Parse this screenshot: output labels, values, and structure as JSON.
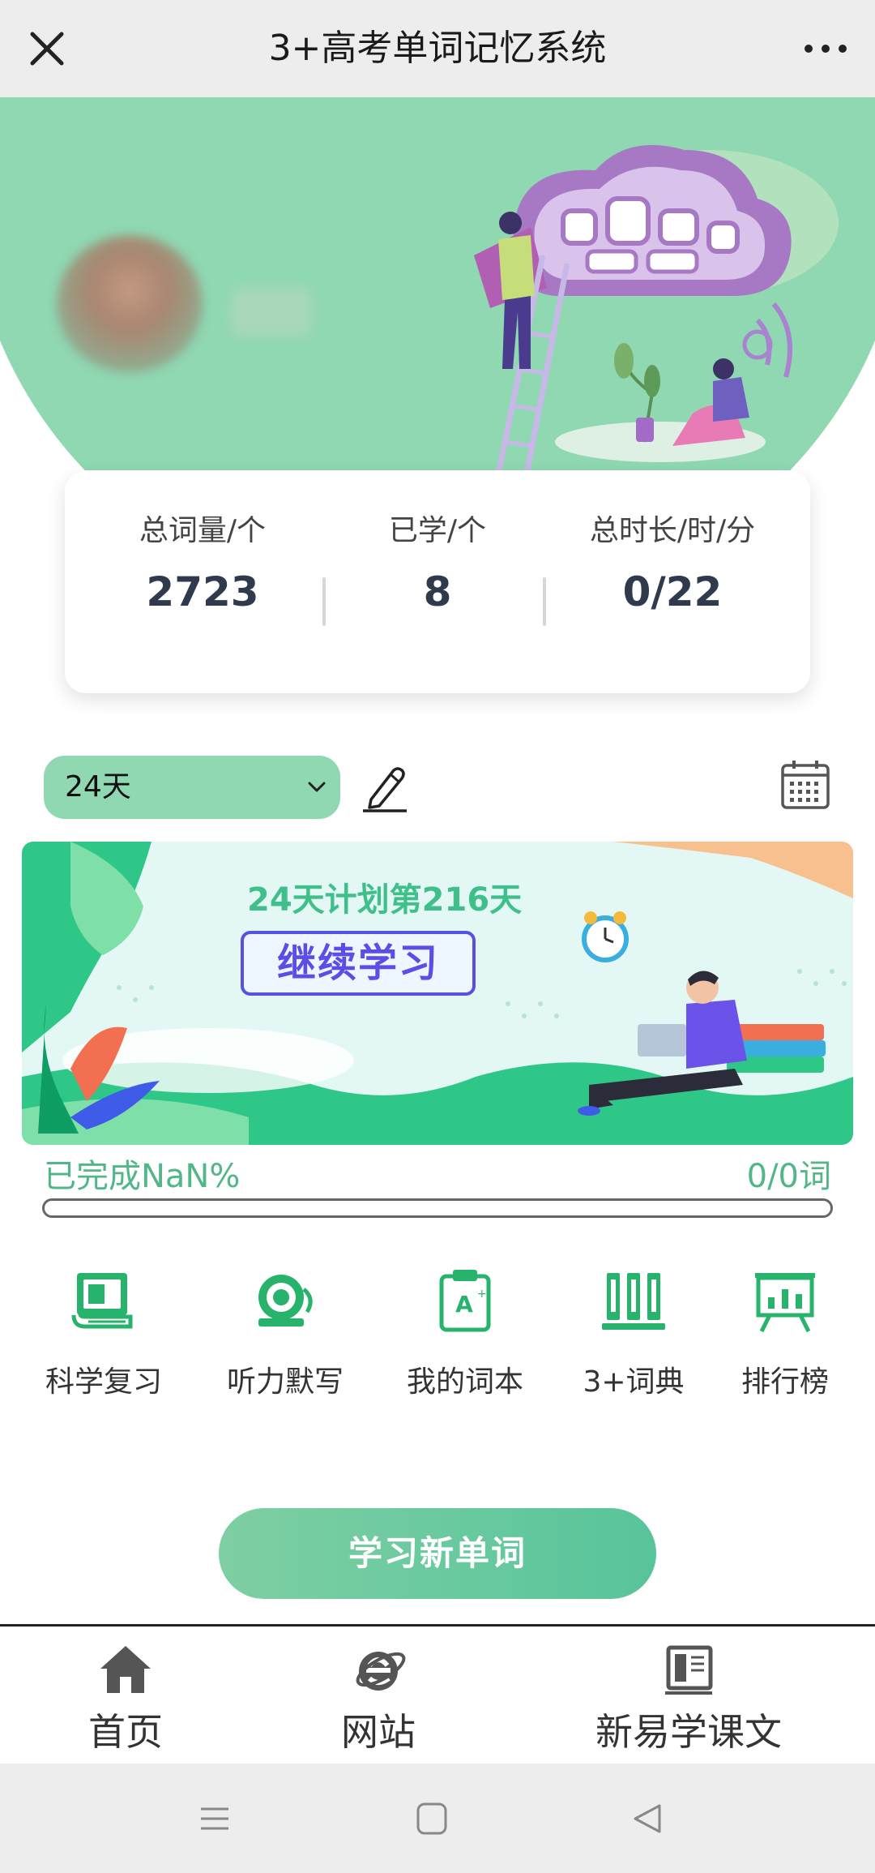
{
  "titlebar": {
    "title": "3+高考单词记忆系统"
  },
  "stats": [
    {
      "label": "总词量/个",
      "value": "2723"
    },
    {
      "label": "已学/个",
      "value": "8"
    },
    {
      "label": "总时长/时/分",
      "value": "0/22"
    }
  ],
  "plan": {
    "selected": "24天"
  },
  "banner": {
    "title": "24天计划第216天",
    "button": "继续学习"
  },
  "progress": {
    "left": "已完成NaN%",
    "right": "0/0词",
    "fraction": 0
  },
  "features": [
    {
      "label": "科学复习",
      "icon": "book-icon"
    },
    {
      "label": "听力默写",
      "icon": "bell-icon"
    },
    {
      "label": "我的词本",
      "icon": "wordbook-icon"
    },
    {
      "label": "3+词典",
      "icon": "dictionary-icon"
    },
    {
      "label": "排行榜",
      "icon": "leaderboard-icon"
    }
  ],
  "cta": {
    "label": "学习新单词"
  },
  "tabs": [
    {
      "label": "首页",
      "icon": "home-icon"
    },
    {
      "label": "网站",
      "icon": "browser-icon"
    },
    {
      "label": "新易学课文",
      "icon": "textbook-icon"
    }
  ],
  "colors": {
    "accent": "#52b788",
    "hero": "#8fd8b2",
    "title_green": "#3fbf8a",
    "button_purple": "#5a4ee6"
  }
}
